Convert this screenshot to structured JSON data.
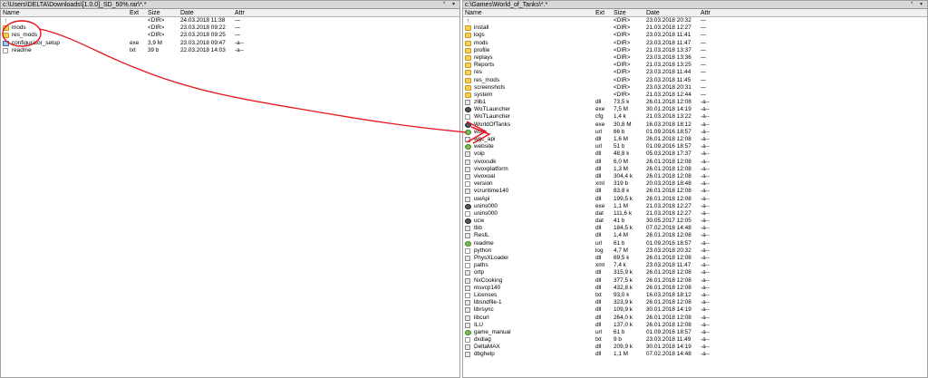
{
  "left": {
    "path": "c:\\Users\\DELTA\\Downloads\\[1.0.0]_SD_50%.rar\\*.*",
    "path_buttons": "* ▾",
    "columns": [
      "Name",
      "Ext",
      "Size",
      "Date",
      "Attr"
    ],
    "rows": [
      {
        "icon": "up",
        "name": "",
        "ext": "",
        "size": "<DIR>",
        "date": "24.03.2018 11:38",
        "attr": "—"
      },
      {
        "icon": "folder",
        "name": "mods",
        "ext": "",
        "size": "<DIR>",
        "date": "23.03.2018 09:22",
        "attr": "—"
      },
      {
        "icon": "folder",
        "name": "res_mods",
        "ext": "",
        "size": "<DIR>",
        "date": "23.03.2018 09:25",
        "attr": "—"
      },
      {
        "icon": "exe",
        "name": "configurator_setup",
        "ext": "exe",
        "size": "3,9 M",
        "date": "23.03.2018 09:47",
        "attr": "-a--"
      },
      {
        "icon": "file",
        "name": "readme",
        "ext": "txt",
        "size": "39 b",
        "date": "22.03.2018 14:03",
        "attr": "-a--"
      }
    ]
  },
  "right": {
    "path": "c:\\Games\\World_of_Tanks\\*.*",
    "path_buttons": "* ▾",
    "columns": [
      "Name",
      "Ext",
      "Size",
      "Date",
      "Attr"
    ],
    "rows": [
      {
        "icon": "up",
        "name": "",
        "ext": "",
        "size": "<DIR>",
        "date": "23.03.2018 20:32",
        "attr": "—"
      },
      {
        "icon": "folder",
        "name": "install",
        "ext": "",
        "size": "<DIR>",
        "date": "21.03.2018 12:27",
        "attr": "—"
      },
      {
        "icon": "folder",
        "name": "logs",
        "ext": "",
        "size": "<DIR>",
        "date": "23.03.2018 11:41",
        "attr": "—"
      },
      {
        "icon": "folder",
        "name": "mods",
        "ext": "",
        "size": "<DIR>",
        "date": "23.03.2018 11:47",
        "attr": "—"
      },
      {
        "icon": "folder",
        "name": "profile",
        "ext": "",
        "size": "<DIR>",
        "date": "21.03.2018 13:37",
        "attr": "—"
      },
      {
        "icon": "folder",
        "name": "replays",
        "ext": "",
        "size": "<DIR>",
        "date": "23.03.2018 13:36",
        "attr": "—"
      },
      {
        "icon": "folder",
        "name": "Reports",
        "ext": "",
        "size": "<DIR>",
        "date": "21.03.2018 13:25",
        "attr": "—"
      },
      {
        "icon": "folder",
        "name": "res",
        "ext": "",
        "size": "<DIR>",
        "date": "23.03.2018 11:44",
        "attr": "—"
      },
      {
        "icon": "folder",
        "name": "res_mods",
        "ext": "",
        "size": "<DIR>",
        "date": "23.03.2018 11:45",
        "attr": "—"
      },
      {
        "icon": "folder",
        "name": "screenshots",
        "ext": "",
        "size": "<DIR>",
        "date": "23.03.2018 20:31",
        "attr": "—"
      },
      {
        "icon": "folder",
        "name": "system",
        "ext": "",
        "size": "<DIR>",
        "date": "21.03.2018 12:44",
        "attr": "—"
      },
      {
        "icon": "dll",
        "name": "zlib1",
        "ext": "dll",
        "size": "73,5 k",
        "date": "26.01.2018 12:08",
        "attr": "-a--"
      },
      {
        "icon": "app",
        "name": "WoTLauncher",
        "ext": "exe",
        "size": "7,5 M",
        "date": "30.01.2018 14:19",
        "attr": "-a--"
      },
      {
        "icon": "file",
        "name": "WoTLauncher",
        "ext": "cfg",
        "size": "1,4 k",
        "date": "21.03.2018 13:22",
        "attr": "-a--"
      },
      {
        "icon": "app",
        "name": "WorldOfTanks",
        "ext": "exe",
        "size": "30,8 M",
        "date": "16.03.2018 18:12",
        "attr": "-a--"
      },
      {
        "icon": "web",
        "name": "wot",
        "ext": "url",
        "size": "66 b",
        "date": "01.09.2016 18:57",
        "attr": "-a--"
      },
      {
        "icon": "dll",
        "name": "wgc_api",
        "ext": "dll",
        "size": "1,6 M",
        "date": "26.01.2018 12:08",
        "attr": "-a--"
      },
      {
        "icon": "web",
        "name": "website",
        "ext": "url",
        "size": "51 b",
        "date": "01.09.2016 18:57",
        "attr": "-a--"
      },
      {
        "icon": "dll",
        "name": "voip",
        "ext": "dll",
        "size": "48,8 k",
        "date": "05.03.2018 17:37",
        "attr": "-a--"
      },
      {
        "icon": "dll",
        "name": "vivoxsdk",
        "ext": "dll",
        "size": "6,0 M",
        "date": "26.01.2018 12:08",
        "attr": "-a--"
      },
      {
        "icon": "dll",
        "name": "vivoxplatform",
        "ext": "dll",
        "size": "1,3 M",
        "date": "26.01.2018 12:08",
        "attr": "-a--"
      },
      {
        "icon": "dll",
        "name": "vivoxoal",
        "ext": "dll",
        "size": "304,4 k",
        "date": "26.01.2018 12:08",
        "attr": "-a--"
      },
      {
        "icon": "file",
        "name": "version",
        "ext": "xml",
        "size": "319 b",
        "date": "20.03.2018 18:48",
        "attr": "-a--"
      },
      {
        "icon": "dll",
        "name": "vcruntime140",
        "ext": "dll",
        "size": "83,8 k",
        "date": "26.01.2018 12:08",
        "attr": "-a--"
      },
      {
        "icon": "dll",
        "name": "uwApi",
        "ext": "dll",
        "size": "199,5 k",
        "date": "26.01.2018 12:08",
        "attr": "-a--"
      },
      {
        "icon": "app",
        "name": "unins000",
        "ext": "exe",
        "size": "1,1 M",
        "date": "21.03.2018 12:27",
        "attr": "-a--"
      },
      {
        "icon": "file",
        "name": "unins000",
        "ext": "dat",
        "size": "111,6 k",
        "date": "21.03.2018 12:27",
        "attr": "-a--"
      },
      {
        "icon": "app",
        "name": "ucw",
        "ext": "dat",
        "size": "41 b",
        "date": "30.05.2017 12:05",
        "attr": "-a--"
      },
      {
        "icon": "dll",
        "name": "tbb",
        "ext": "dll",
        "size": "184,5 k",
        "date": "07.02.2018 14:48",
        "attr": "-a--"
      },
      {
        "icon": "dll",
        "name": "ResIL",
        "ext": "dll",
        "size": "1,4 M",
        "date": "26.01.2018 12:08",
        "attr": "-a--"
      },
      {
        "icon": "web",
        "name": "readme",
        "ext": "url",
        "size": "61 b",
        "date": "01.09.2016 18:57",
        "attr": "-a--"
      },
      {
        "icon": "file",
        "name": "python",
        "ext": "log",
        "size": "4,7 M",
        "date": "23.03.2018 20:32",
        "attr": "-a--"
      },
      {
        "icon": "dll",
        "name": "PhysXLoader",
        "ext": "dll",
        "size": "69,5 k",
        "date": "26.01.2018 12:08",
        "attr": "-a--"
      },
      {
        "icon": "file",
        "name": "paths",
        "ext": "xml",
        "size": "7,4 k",
        "date": "23.03.2018 11:47",
        "attr": "-a--"
      },
      {
        "icon": "dll",
        "name": "ortp",
        "ext": "dll",
        "size": "315,9 k",
        "date": "26.01.2018 12:08",
        "attr": "-a--"
      },
      {
        "icon": "dll",
        "name": "NxCooking",
        "ext": "dll",
        "size": "377,5 k",
        "date": "26.01.2018 12:08",
        "attr": "-a--"
      },
      {
        "icon": "dll",
        "name": "msvcp140",
        "ext": "dll",
        "size": "432,8 k",
        "date": "26.01.2018 12:08",
        "attr": "-a--"
      },
      {
        "icon": "file",
        "name": "Licenses",
        "ext": "txt",
        "size": "93,0 k",
        "date": "16.03.2018 18:12",
        "attr": "-a--"
      },
      {
        "icon": "dll",
        "name": "libsndfile-1",
        "ext": "dll",
        "size": "323,9 k",
        "date": "26.01.2018 12:08",
        "attr": "-a--"
      },
      {
        "icon": "dll",
        "name": "librsync",
        "ext": "dll",
        "size": "109,9 k",
        "date": "30.01.2018 14:19",
        "attr": "-a--"
      },
      {
        "icon": "dll",
        "name": "libcurl",
        "ext": "dll",
        "size": "264,0 k",
        "date": "26.01.2018 12:08",
        "attr": "-a--"
      },
      {
        "icon": "dll",
        "name": "ILU",
        "ext": "dll",
        "size": "137,0 k",
        "date": "26.01.2018 12:08",
        "attr": "-a--"
      },
      {
        "icon": "web",
        "name": "game_manual",
        "ext": "url",
        "size": "61 b",
        "date": "01.09.2016 18:57",
        "attr": "-a--"
      },
      {
        "icon": "file",
        "name": "dxdiag",
        "ext": "txt",
        "size": "9 b",
        "date": "23.03.2018 11:49",
        "attr": "-a--"
      },
      {
        "icon": "dll",
        "name": "DeltaMAX",
        "ext": "dll",
        "size": "209,9 k",
        "date": "30.01.2018 14:19",
        "attr": "-a--"
      },
      {
        "icon": "dll",
        "name": "dbghelp",
        "ext": "dll",
        "size": "1,1 M",
        "date": "07.02.2018 14:48",
        "attr": "-a--"
      }
    ]
  },
  "annotation_color": "#e8141e"
}
